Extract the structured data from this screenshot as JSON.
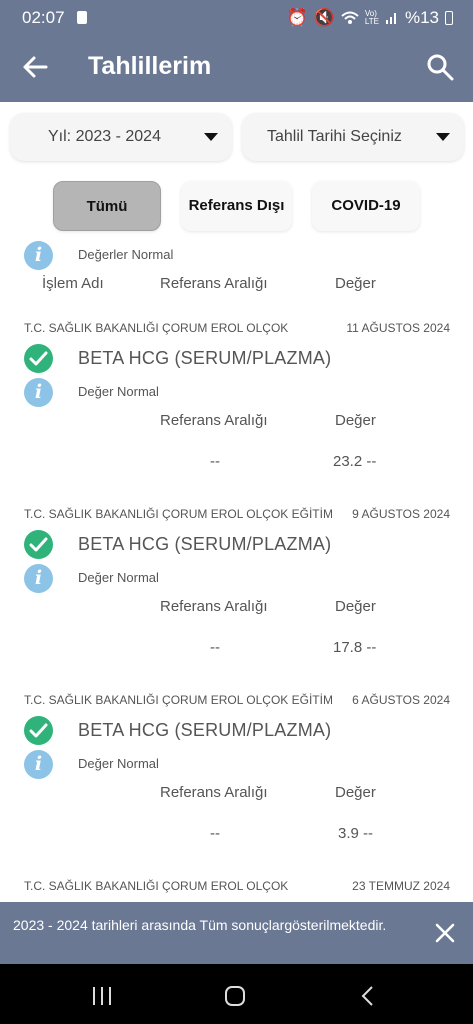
{
  "status_bar": {
    "time": "02:07",
    "battery": "%13"
  },
  "header": {
    "title": "Tahlillerim"
  },
  "filters": {
    "year": "Yıl: 2023 - 2024",
    "date": "Tahlil Tarihi Seçiniz"
  },
  "tabs": [
    {
      "label": "Tümü"
    },
    {
      "label": "Referans Dışı"
    },
    {
      "label": "COVID-19"
    }
  ],
  "partial_card": {
    "status": "Değerler Normal",
    "headers": [
      "İşlem Adı",
      "Referans Aralığı",
      "Değer"
    ]
  },
  "results": [
    {
      "institution": "T.C. SAĞLIK BAKANLIĞI ÇORUM EROL OLÇOK",
      "date": "11 AĞUSTOS 2024",
      "test": "BETA HCG (SERUM/PLAZMA)",
      "status": "Değer Normal",
      "ref_label": "Referans Aralığı",
      "value_label": "Değer",
      "ref_value": "--",
      "value": "23.2 --"
    },
    {
      "institution": "T.C. SAĞLIK BAKANLIĞI ÇORUM EROL OLÇOK EĞİTİM",
      "date": "9 AĞUSTOS 2024",
      "test": "BETA HCG (SERUM/PLAZMA)",
      "status": "Değer Normal",
      "ref_label": "Referans Aralığı",
      "value_label": "Değer",
      "ref_value": "--",
      "value": "17.8 --"
    },
    {
      "institution": "T.C. SAĞLIK BAKANLIĞI ÇORUM EROL OLÇOK EĞİTİM",
      "date": "6 AĞUSTOS 2024",
      "test": "BETA HCG (SERUM/PLAZMA)",
      "status": "Değer Normal",
      "ref_label": "Referans Aralığı",
      "value_label": "Değer",
      "ref_value": "--",
      "value": "3.9 --"
    }
  ],
  "last_card": {
    "institution": "T.C. SAĞLIK BAKANLIĞI ÇORUM EROL OLÇOK",
    "date": "23 TEMMUZ 2024"
  },
  "snackbar": {
    "message": "2023 - 2024 tarihleri arasında Tüm sonuçlargösterilmektedir."
  },
  "icons": {
    "back": "arrow-left-icon",
    "search": "search-icon",
    "info": "info-icon",
    "check": "check-circle-icon",
    "close": "close-icon"
  },
  "colors": {
    "header": "#6b7893",
    "check": "#2fb37a",
    "info": "#8cc3e6"
  }
}
